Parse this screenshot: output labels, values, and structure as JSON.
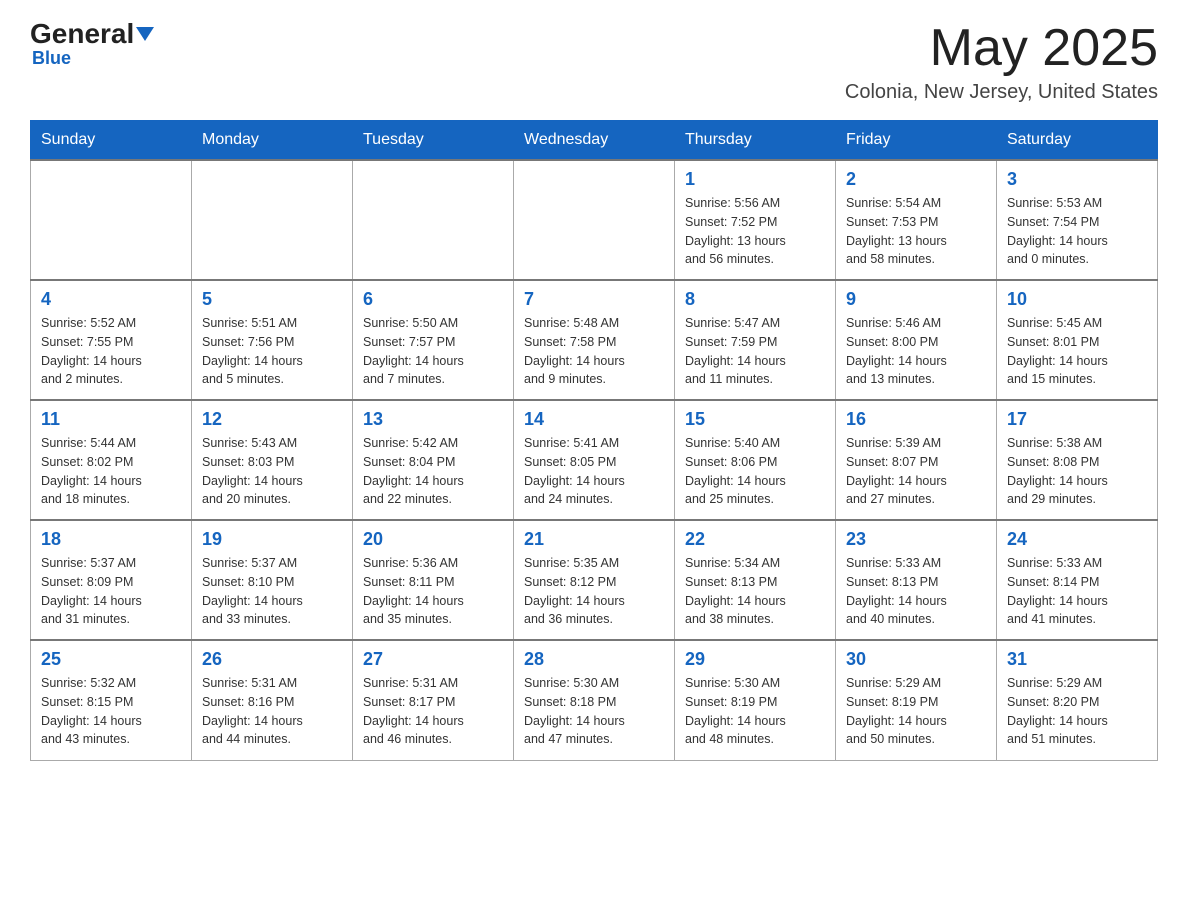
{
  "header": {
    "logo_general": "General",
    "logo_blue": "Blue",
    "month_title": "May 2025",
    "location": "Colonia, New Jersey, United States"
  },
  "weekdays": [
    "Sunday",
    "Monday",
    "Tuesday",
    "Wednesday",
    "Thursday",
    "Friday",
    "Saturday"
  ],
  "weeks": [
    [
      {
        "day": "",
        "info": ""
      },
      {
        "day": "",
        "info": ""
      },
      {
        "day": "",
        "info": ""
      },
      {
        "day": "",
        "info": ""
      },
      {
        "day": "1",
        "info": "Sunrise: 5:56 AM\nSunset: 7:52 PM\nDaylight: 13 hours\nand 56 minutes."
      },
      {
        "day": "2",
        "info": "Sunrise: 5:54 AM\nSunset: 7:53 PM\nDaylight: 13 hours\nand 58 minutes."
      },
      {
        "day": "3",
        "info": "Sunrise: 5:53 AM\nSunset: 7:54 PM\nDaylight: 14 hours\nand 0 minutes."
      }
    ],
    [
      {
        "day": "4",
        "info": "Sunrise: 5:52 AM\nSunset: 7:55 PM\nDaylight: 14 hours\nand 2 minutes."
      },
      {
        "day": "5",
        "info": "Sunrise: 5:51 AM\nSunset: 7:56 PM\nDaylight: 14 hours\nand 5 minutes."
      },
      {
        "day": "6",
        "info": "Sunrise: 5:50 AM\nSunset: 7:57 PM\nDaylight: 14 hours\nand 7 minutes."
      },
      {
        "day": "7",
        "info": "Sunrise: 5:48 AM\nSunset: 7:58 PM\nDaylight: 14 hours\nand 9 minutes."
      },
      {
        "day": "8",
        "info": "Sunrise: 5:47 AM\nSunset: 7:59 PM\nDaylight: 14 hours\nand 11 minutes."
      },
      {
        "day": "9",
        "info": "Sunrise: 5:46 AM\nSunset: 8:00 PM\nDaylight: 14 hours\nand 13 minutes."
      },
      {
        "day": "10",
        "info": "Sunrise: 5:45 AM\nSunset: 8:01 PM\nDaylight: 14 hours\nand 15 minutes."
      }
    ],
    [
      {
        "day": "11",
        "info": "Sunrise: 5:44 AM\nSunset: 8:02 PM\nDaylight: 14 hours\nand 18 minutes."
      },
      {
        "day": "12",
        "info": "Sunrise: 5:43 AM\nSunset: 8:03 PM\nDaylight: 14 hours\nand 20 minutes."
      },
      {
        "day": "13",
        "info": "Sunrise: 5:42 AM\nSunset: 8:04 PM\nDaylight: 14 hours\nand 22 minutes."
      },
      {
        "day": "14",
        "info": "Sunrise: 5:41 AM\nSunset: 8:05 PM\nDaylight: 14 hours\nand 24 minutes."
      },
      {
        "day": "15",
        "info": "Sunrise: 5:40 AM\nSunset: 8:06 PM\nDaylight: 14 hours\nand 25 minutes."
      },
      {
        "day": "16",
        "info": "Sunrise: 5:39 AM\nSunset: 8:07 PM\nDaylight: 14 hours\nand 27 minutes."
      },
      {
        "day": "17",
        "info": "Sunrise: 5:38 AM\nSunset: 8:08 PM\nDaylight: 14 hours\nand 29 minutes."
      }
    ],
    [
      {
        "day": "18",
        "info": "Sunrise: 5:37 AM\nSunset: 8:09 PM\nDaylight: 14 hours\nand 31 minutes."
      },
      {
        "day": "19",
        "info": "Sunrise: 5:37 AM\nSunset: 8:10 PM\nDaylight: 14 hours\nand 33 minutes."
      },
      {
        "day": "20",
        "info": "Sunrise: 5:36 AM\nSunset: 8:11 PM\nDaylight: 14 hours\nand 35 minutes."
      },
      {
        "day": "21",
        "info": "Sunrise: 5:35 AM\nSunset: 8:12 PM\nDaylight: 14 hours\nand 36 minutes."
      },
      {
        "day": "22",
        "info": "Sunrise: 5:34 AM\nSunset: 8:13 PM\nDaylight: 14 hours\nand 38 minutes."
      },
      {
        "day": "23",
        "info": "Sunrise: 5:33 AM\nSunset: 8:13 PM\nDaylight: 14 hours\nand 40 minutes."
      },
      {
        "day": "24",
        "info": "Sunrise: 5:33 AM\nSunset: 8:14 PM\nDaylight: 14 hours\nand 41 minutes."
      }
    ],
    [
      {
        "day": "25",
        "info": "Sunrise: 5:32 AM\nSunset: 8:15 PM\nDaylight: 14 hours\nand 43 minutes."
      },
      {
        "day": "26",
        "info": "Sunrise: 5:31 AM\nSunset: 8:16 PM\nDaylight: 14 hours\nand 44 minutes."
      },
      {
        "day": "27",
        "info": "Sunrise: 5:31 AM\nSunset: 8:17 PM\nDaylight: 14 hours\nand 46 minutes."
      },
      {
        "day": "28",
        "info": "Sunrise: 5:30 AM\nSunset: 8:18 PM\nDaylight: 14 hours\nand 47 minutes."
      },
      {
        "day": "29",
        "info": "Sunrise: 5:30 AM\nSunset: 8:19 PM\nDaylight: 14 hours\nand 48 minutes."
      },
      {
        "day": "30",
        "info": "Sunrise: 5:29 AM\nSunset: 8:19 PM\nDaylight: 14 hours\nand 50 minutes."
      },
      {
        "day": "31",
        "info": "Sunrise: 5:29 AM\nSunset: 8:20 PM\nDaylight: 14 hours\nand 51 minutes."
      }
    ]
  ]
}
